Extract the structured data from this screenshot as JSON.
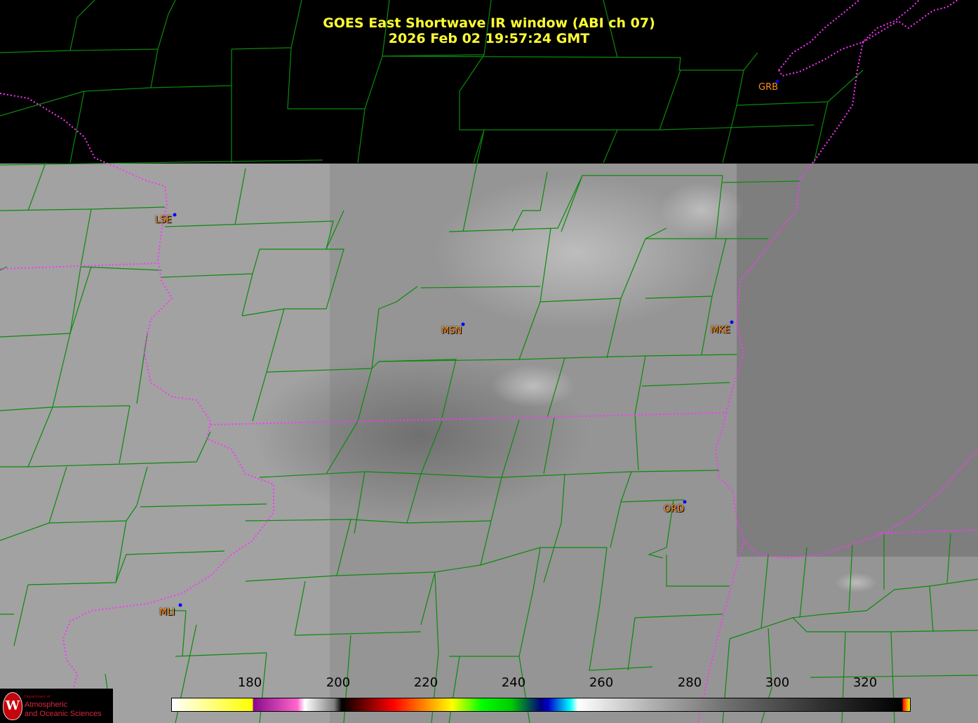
{
  "title": {
    "line1": "GOES East Shortwave IR window (ABI ch 07)",
    "line2": "2026 Feb 02  19:57:24 GMT"
  },
  "cities": [
    {
      "code": "GRB"
    },
    {
      "code": "LSE"
    },
    {
      "code": "MSN"
    },
    {
      "code": "MKE"
    },
    {
      "code": "ORD"
    },
    {
      "code": "MLI"
    }
  ],
  "colorbar": {
    "tick_labels": [
      "180",
      "200",
      "220",
      "240",
      "260",
      "280",
      "300",
      "320"
    ]
  },
  "logo": {
    "department": "Department of",
    "name_line1": "Atmospheric",
    "name_line2": "and Oceanic Sciences"
  },
  "colors": {
    "title": "#ffff33",
    "city_label": "#ff8c1a",
    "county_lines": "#0b8a0b",
    "state_lines": "#ff33ff",
    "station_dot": "#0000ff"
  }
}
